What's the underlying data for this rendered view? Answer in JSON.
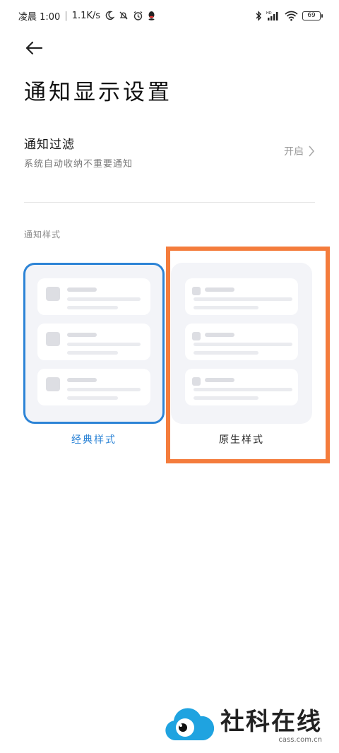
{
  "status_bar": {
    "time": "凌晨 1:00",
    "separator": "|",
    "network_speed": "1.1K/s",
    "battery": "69",
    "icons": [
      "moon-icon",
      "bell-off-icon",
      "alarm-icon",
      "qq-icon",
      "bluetooth-icon",
      "signal-icon",
      "wifi-icon",
      "battery-icon"
    ]
  },
  "header": {
    "back_icon": "back-arrow-icon",
    "title": "通知显示设置"
  },
  "filter": {
    "title": "通知过滤",
    "subtitle": "系统自动收纳不重要通知",
    "value": "开启"
  },
  "styles": {
    "section_label": "通知样式",
    "options": [
      {
        "label": "经典样式",
        "selected": true
      },
      {
        "label": "原生样式",
        "selected": false
      }
    ]
  },
  "colors": {
    "accent": "#2d84d6",
    "annotation": "#f47c3c"
  },
  "watermark": {
    "name": "社科在线",
    "url": "cass.com.cn"
  }
}
